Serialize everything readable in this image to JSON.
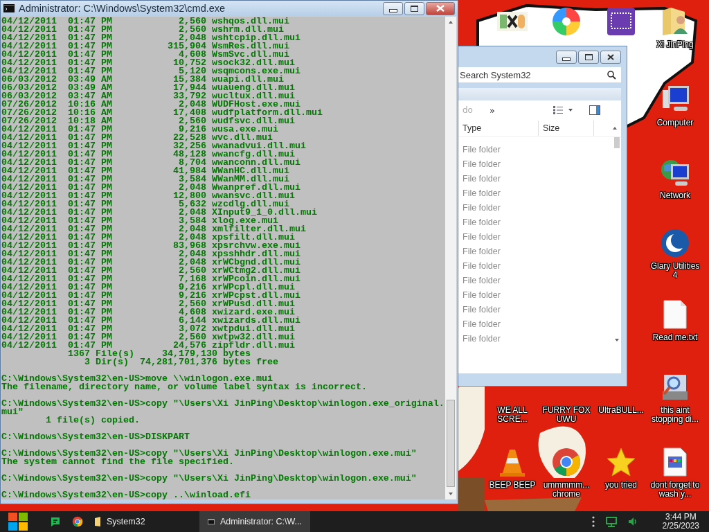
{
  "console": {
    "title": "Administrator: C:\\Windows\\System32\\cmd.exe",
    "listing": [
      {
        "date": "04/12/2011",
        "time": "01:47 PM",
        "size": "2,560",
        "name": "wshqos.dll.mui"
      },
      {
        "date": "04/12/2011",
        "time": "01:47 PM",
        "size": "2,560",
        "name": "wshrm.dll.mui"
      },
      {
        "date": "04/12/2011",
        "time": "01:47 PM",
        "size": "2,048",
        "name": "wshtcpip.dll.mui"
      },
      {
        "date": "04/12/2011",
        "time": "01:47 PM",
        "size": "315,904",
        "name": "WsmRes.dll.mui"
      },
      {
        "date": "04/12/2011",
        "time": "01:47 PM",
        "size": "4,608",
        "name": "WsmSvc.dll.mui"
      },
      {
        "date": "04/12/2011",
        "time": "01:47 PM",
        "size": "10,752",
        "name": "wsock32.dll.mui"
      },
      {
        "date": "04/12/2011",
        "time": "01:47 PM",
        "size": "5,120",
        "name": "wsqmcons.exe.mui"
      },
      {
        "date": "06/03/2012",
        "time": "03:49 AM",
        "size": "15,384",
        "name": "wuapi.dll.mui"
      },
      {
        "date": "06/03/2012",
        "time": "03:49 AM",
        "size": "17,944",
        "name": "wuaueng.dll.mui"
      },
      {
        "date": "06/03/2012",
        "time": "03:47 AM",
        "size": "33,792",
        "name": "wucltux.dll.mui"
      },
      {
        "date": "07/26/2012",
        "time": "10:16 AM",
        "size": "2,048",
        "name": "WUDFHost.exe.mui"
      },
      {
        "date": "07/26/2012",
        "time": "10:16 AM",
        "size": "17,408",
        "name": "wudfplatform.dll.mui"
      },
      {
        "date": "07/26/2012",
        "time": "10:18 AM",
        "size": "2,560",
        "name": "wudfsvc.dll.mui"
      },
      {
        "date": "04/12/2011",
        "time": "01:47 PM",
        "size": "9,216",
        "name": "wusa.exe.mui"
      },
      {
        "date": "04/12/2011",
        "time": "01:47 PM",
        "size": "22,528",
        "name": "wvc.dll.mui"
      },
      {
        "date": "04/12/2011",
        "time": "01:47 PM",
        "size": "32,256",
        "name": "wwanadvui.dll.mui"
      },
      {
        "date": "04/12/2011",
        "time": "01:47 PM",
        "size": "48,128",
        "name": "wwancfg.dll.mui"
      },
      {
        "date": "04/12/2011",
        "time": "01:47 PM",
        "size": "8,704",
        "name": "wwanconn.dll.mui"
      },
      {
        "date": "04/12/2011",
        "time": "01:47 PM",
        "size": "41,984",
        "name": "WWanHC.dll.mui"
      },
      {
        "date": "04/12/2011",
        "time": "01:47 PM",
        "size": "3,584",
        "name": "WWanMM.dll.mui"
      },
      {
        "date": "04/12/2011",
        "time": "01:47 PM",
        "size": "2,048",
        "name": "Wwanpref.dll.mui"
      },
      {
        "date": "04/12/2011",
        "time": "01:47 PM",
        "size": "12,800",
        "name": "wwansvc.dll.mui"
      },
      {
        "date": "04/12/2011",
        "time": "01:47 PM",
        "size": "5,632",
        "name": "wzcdlg.dll.mui"
      },
      {
        "date": "04/12/2011",
        "time": "01:47 PM",
        "size": "2,048",
        "name": "XInput9_1_0.dll.mui"
      },
      {
        "date": "04/12/2011",
        "time": "01:47 PM",
        "size": "3,584",
        "name": "xlog.exe.mui"
      },
      {
        "date": "04/12/2011",
        "time": "01:47 PM",
        "size": "2,048",
        "name": "xmlfilter.dll.mui"
      },
      {
        "date": "04/12/2011",
        "time": "01:47 PM",
        "size": "2,048",
        "name": "xpsfilt.dll.mui"
      },
      {
        "date": "04/12/2011",
        "time": "01:47 PM",
        "size": "83,968",
        "name": "xpsrchvw.exe.mui"
      },
      {
        "date": "04/12/2011",
        "time": "01:47 PM",
        "size": "2,048",
        "name": "xpsshhdr.dll.mui"
      },
      {
        "date": "04/12/2011",
        "time": "01:47 PM",
        "size": "2,048",
        "name": "xrWCbgnd.dll.mui"
      },
      {
        "date": "04/12/2011",
        "time": "01:47 PM",
        "size": "2,560",
        "name": "xrWCtmg2.dll.mui"
      },
      {
        "date": "04/12/2011",
        "time": "01:47 PM",
        "size": "7,168",
        "name": "xrWPcoin.dll.mui"
      },
      {
        "date": "04/12/2011",
        "time": "01:47 PM",
        "size": "9,216",
        "name": "xrWPcpl.dll.mui"
      },
      {
        "date": "04/12/2011",
        "time": "01:47 PM",
        "size": "9,216",
        "name": "xrWPcpst.dll.mui"
      },
      {
        "date": "04/12/2011",
        "time": "01:47 PM",
        "size": "2,560",
        "name": "xrWPusd.dll.mui"
      },
      {
        "date": "04/12/2011",
        "time": "01:47 PM",
        "size": "4,608",
        "name": "xwizard.exe.mui"
      },
      {
        "date": "04/12/2011",
        "time": "01:47 PM",
        "size": "6,144",
        "name": "xwizards.dll.mui"
      },
      {
        "date": "04/12/2011",
        "time": "01:47 PM",
        "size": "3,072",
        "name": "xwtpdui.dll.mui"
      },
      {
        "date": "04/12/2011",
        "time": "01:47 PM",
        "size": "2,560",
        "name": "xwtpw32.dll.mui"
      },
      {
        "date": "04/12/2011",
        "time": "01:47 PM",
        "size": "24,576",
        "name": "zipfldr.dll.mui"
      }
    ],
    "blocks": [
      [
        "            1367 File(s)     34,179,130 bytes",
        "               3 Dir(s)  74,281,701,376 bytes free"
      ],
      [
        "C:\\Windows\\System32\\en-US>move \\\\winlogon.exe.mui",
        "The filename, directory name, or volume label syntax is incorrect."
      ],
      [
        "C:\\Windows\\System32\\en-US>copy \"\\Users\\Xi JinPing\\Desktop\\winlogon.exe_original.",
        "mui\"",
        "        1 file(s) copied."
      ],
      [
        "C:\\Windows\\System32\\en-US>DISKPART"
      ],
      [
        "C:\\Windows\\System32\\en-US>copy \"\\Users\\Xi JinPing\\Desktop\\winlogon.exe.mui\"",
        "The system cannot find the file specified."
      ],
      [
        "C:\\Windows\\System32\\en-US>copy \"\\Users\\Xi JinPing\\Desktop\\winlogon.exe.mui\""
      ],
      [
        "C:\\Windows\\System32\\en-US>copy ..\\winload.efi"
      ]
    ]
  },
  "explorer": {
    "search": {
      "placeholder": "Search System32"
    },
    "toolbar_text": "do",
    "toolbar_chevron": "»",
    "columns": [
      "Type",
      "Size"
    ],
    "rows": [
      "File folder",
      "File folder",
      "File folder",
      "File folder",
      "File folder",
      "File folder",
      "File folder",
      "File folder",
      "File folder",
      "File folder",
      "File folder",
      "File folder",
      "File folder",
      "File folder"
    ]
  },
  "desktop_icons": [
    {
      "kind": "hex-editor"
    },
    {
      "kind": "pinwheel"
    },
    {
      "kind": "chip"
    },
    {
      "kind": "user-folder",
      "label": "Xi JinPing"
    },
    {
      "kind": "computer",
      "label": "Computer"
    },
    {
      "kind": "network",
      "label": "Network"
    },
    {
      "kind": "crescent",
      "label": "Glary Utilities 4"
    },
    {
      "kind": "text-file",
      "label": "Read me.txt"
    },
    {
      "kind": "covered",
      "label": "WE ALL SCRE..."
    },
    {
      "kind": "covered",
      "label": "FURRY FOX UWU"
    },
    {
      "kind": "covered",
      "label": "UltraBULL..."
    },
    {
      "kind": "search-computer",
      "label": "this aint stopping di..."
    },
    {
      "kind": "cone",
      "label": "BEEP BEEP"
    },
    {
      "kind": "chrome",
      "label": "ummmmm... chrome"
    },
    {
      "kind": "star",
      "label": "you tried"
    },
    {
      "kind": "document",
      "label": "dont forget to wash y..."
    }
  ],
  "taskbar": {
    "windows": [
      {
        "kind": "folder",
        "label": "System32",
        "selected": false
      },
      {
        "kind": "console",
        "label": "Administrator: C:\\W...",
        "selected": true
      }
    ],
    "clock": {
      "time": "3:44 PM",
      "date": "2/25/2023"
    }
  }
}
